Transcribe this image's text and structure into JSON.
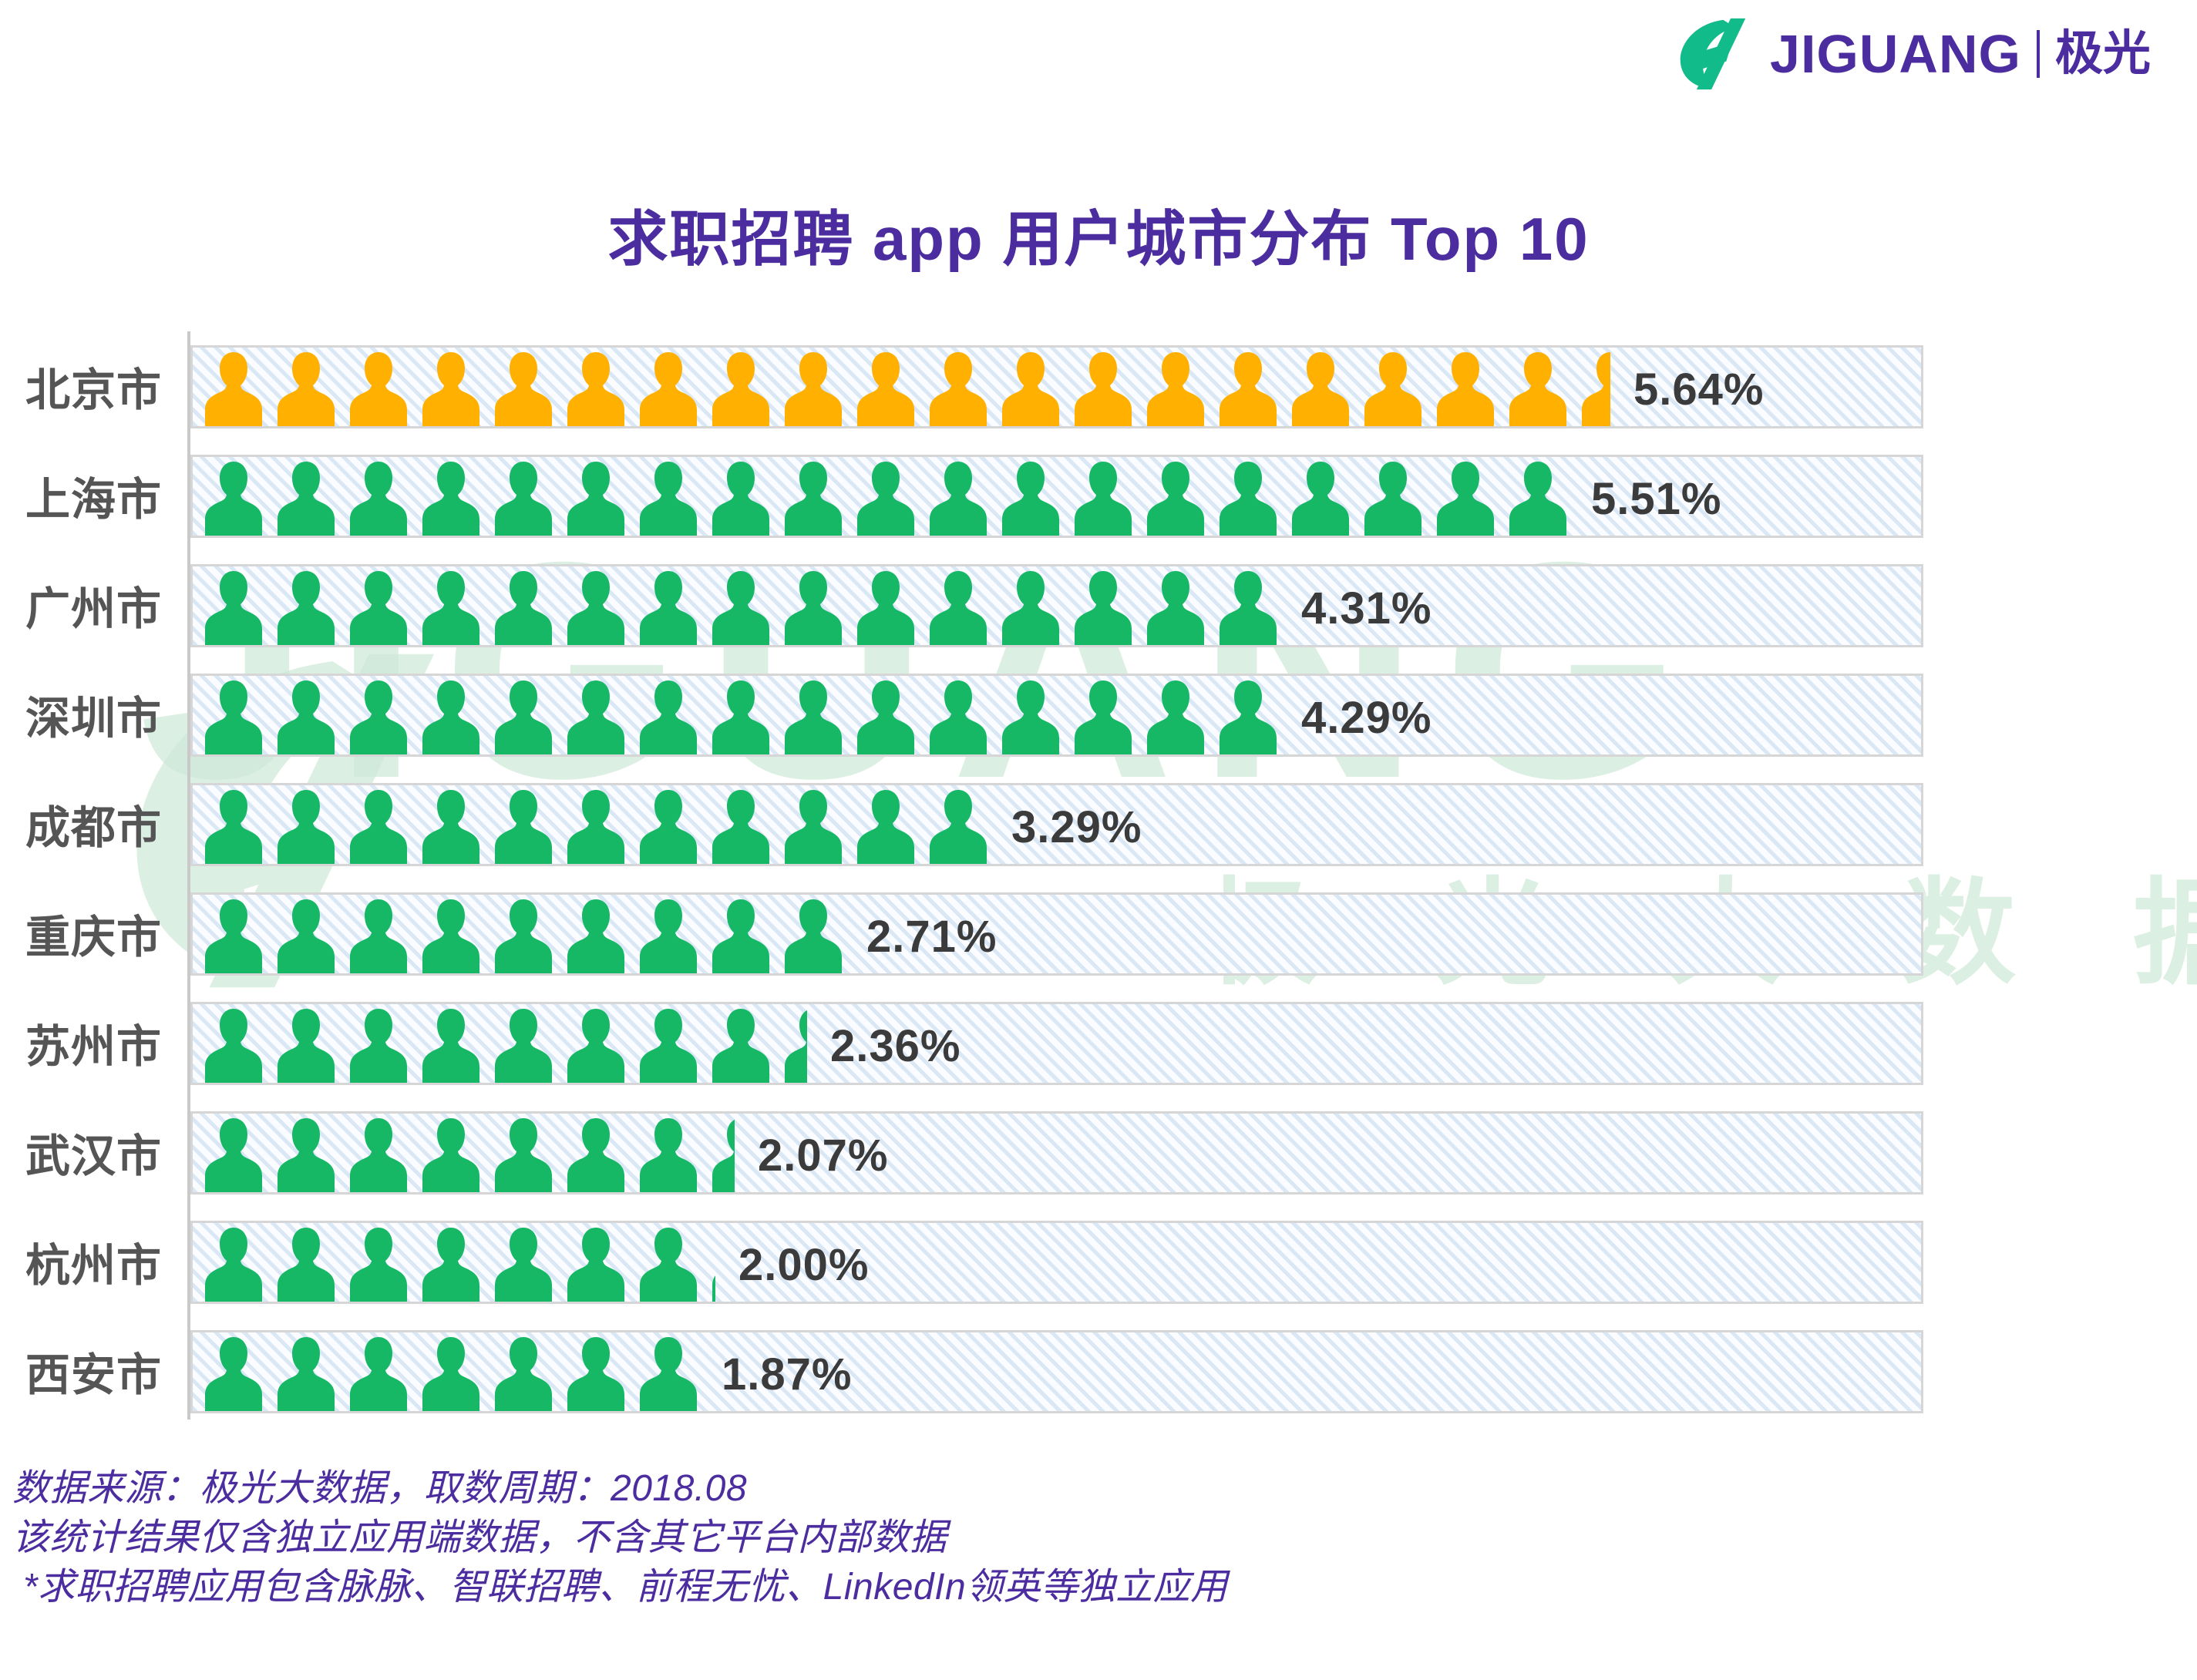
{
  "brand": {
    "logo_word": "JIGUANG",
    "logo_cn": "极光",
    "logo_icon": "jiguang-logo-mark",
    "accent_purple": "#4B2D9F",
    "accent_green": "#16B866",
    "accent_orange": "#FFB000"
  },
  "title": "求职招聘 app 用户城市分布 Top 10",
  "watermark": {
    "word": "JIGUANG",
    "cn": "极 光 大 数 据"
  },
  "footnote": {
    "line1": "数据来源：极光大数据，取数周期：2018.08",
    "line2": "该统计结果仅含独立应用端数据，不含其它平台内部数据",
    "line3": "*求职招聘应用包含脉脉、智联招聘、前程无忧、LinkedIn领英等独立应用"
  },
  "chart_data": {
    "type": "bar",
    "subtype": "pictogram",
    "title": "求职招聘 app 用户城市分布 Top 10",
    "xlabel": "",
    "ylabel": "",
    "unit": "%",
    "icon": "person-icon",
    "icon_value": 0.29,
    "grid": false,
    "legend": null,
    "categories": [
      "北京市",
      "上海市",
      "广州市",
      "深圳市",
      "成都市",
      "重庆市",
      "苏州市",
      "武汉市",
      "杭州市",
      "西安市"
    ],
    "values": [
      5.64,
      5.51,
      4.31,
      4.29,
      3.29,
      2.71,
      2.36,
      2.07,
      2.0,
      1.87
    ],
    "labels": [
      "5.64%",
      "5.51%",
      "4.31%",
      "4.29%",
      "3.29%",
      "2.71%",
      "2.36%",
      "2.07%",
      "2.00%",
      "1.87%"
    ],
    "colors": [
      "#FFB000",
      "#16B866",
      "#16B866",
      "#16B866",
      "#16B866",
      "#16B866",
      "#16B866",
      "#16B866",
      "#16B866",
      "#16B866"
    ],
    "rows": [
      {
        "city": "北京市",
        "value": 5.64,
        "label": "5.64%",
        "color": "#FFB000",
        "icons_full": 19,
        "icons_partial": 0.5
      },
      {
        "city": "上海市",
        "value": 5.51,
        "label": "5.51%",
        "color": "#16B866",
        "icons_full": 19,
        "icons_partial": 0
      },
      {
        "city": "广州市",
        "value": 4.31,
        "label": "4.31%",
        "color": "#16B866",
        "icons_full": 15,
        "icons_partial": 0
      },
      {
        "city": "深圳市",
        "value": 4.29,
        "label": "4.29%",
        "color": "#16B866",
        "icons_full": 15,
        "icons_partial": 0
      },
      {
        "city": "成都市",
        "value": 3.29,
        "label": "3.29%",
        "color": "#16B866",
        "icons_full": 11,
        "icons_partial": 0
      },
      {
        "city": "重庆市",
        "value": 2.71,
        "label": "2.71%",
        "color": "#16B866",
        "icons_full": 9,
        "icons_partial": 0
      },
      {
        "city": "苏州市",
        "value": 2.36,
        "label": "2.36%",
        "color": "#16B866",
        "icons_full": 8,
        "icons_partial": 0.4
      },
      {
        "city": "武汉市",
        "value": 2.07,
        "label": "2.07%",
        "color": "#16B866",
        "icons_full": 7,
        "icons_partial": 0.4
      },
      {
        "city": "杭州市",
        "value": 2.0,
        "label": "2.00%",
        "color": "#16B866",
        "icons_full": 7,
        "icons_partial": 0.08
      },
      {
        "city": "西安市",
        "value": 1.87,
        "label": "1.87%",
        "color": "#16B866",
        "icons_full": 7,
        "icons_partial": 0
      }
    ]
  }
}
